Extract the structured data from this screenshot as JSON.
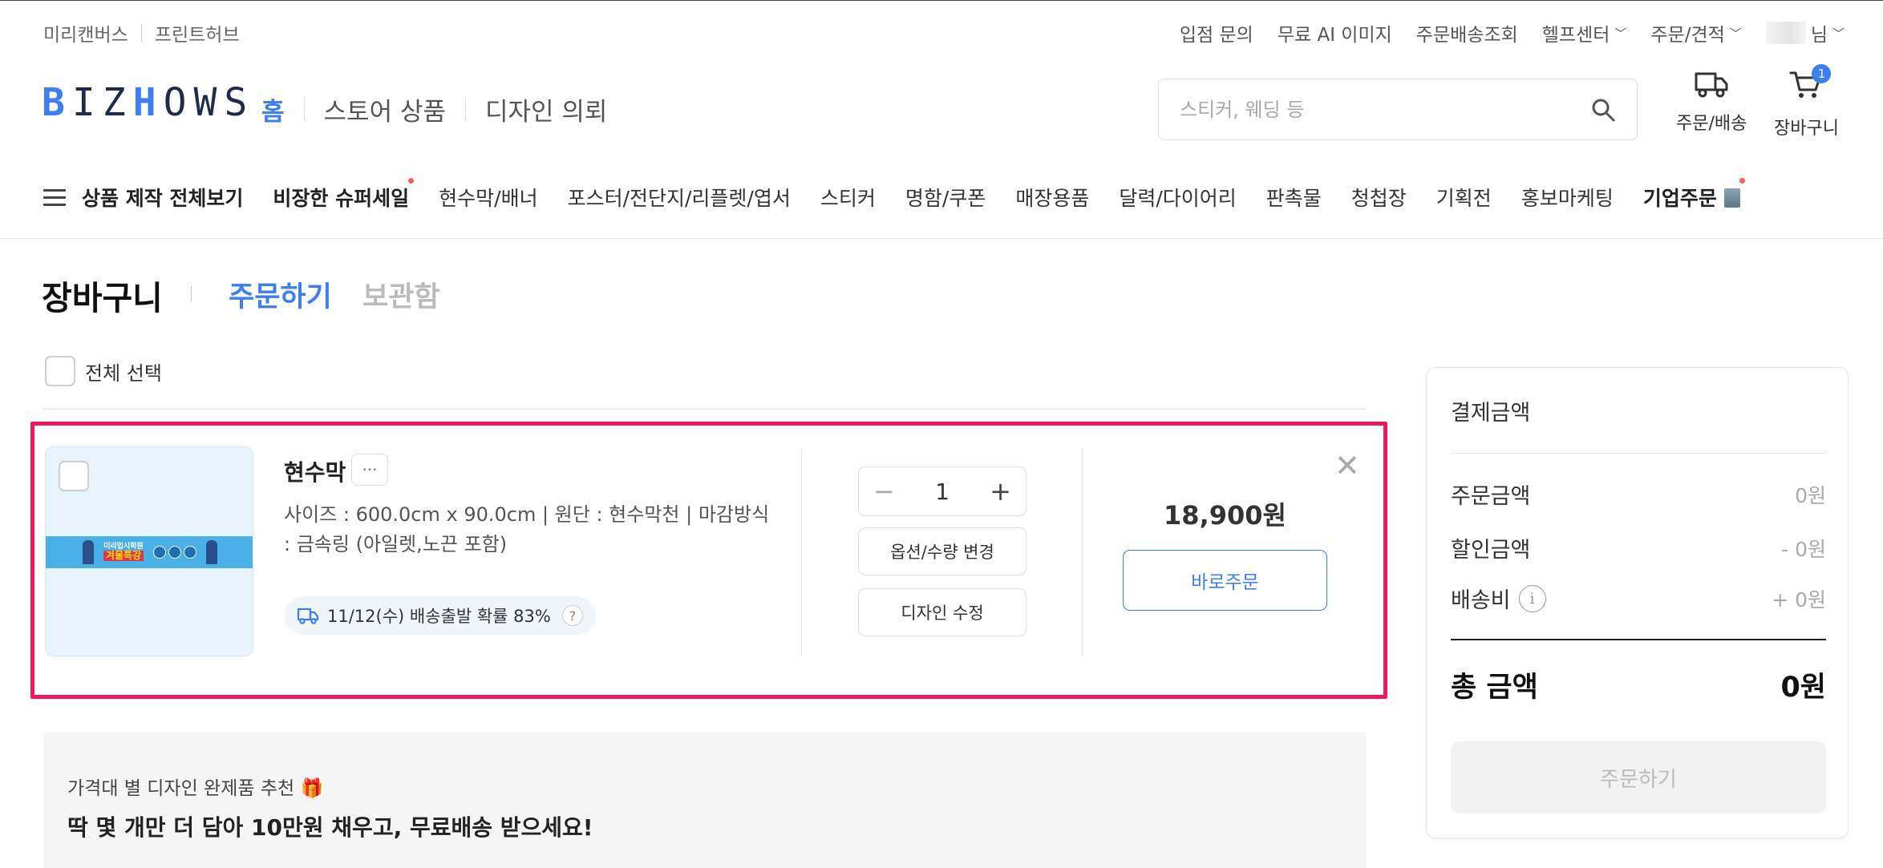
{
  "util": {
    "left": [
      "미리캔버스",
      "프린트허브"
    ],
    "right": {
      "store_apply": "입점 문의",
      "free_ai": "무료 AI 이미지",
      "track": "주문배송조회",
      "help": "헬프센터",
      "order_quote": "주문/견적",
      "user_suffix": "님"
    }
  },
  "header": {
    "logo": "BIZHOWS",
    "nav": [
      "홈",
      "스토어 상품",
      "디자인 의뢰"
    ],
    "search_placeholder": "스티커, 웨딩 등",
    "icons": {
      "orders": "주문/배송",
      "cart": "장바구니",
      "cart_count": "1"
    }
  },
  "category_nav": {
    "all": "상품 제작 전체보기",
    "items": [
      "비장한 슈퍼세일",
      "현수막/배너",
      "포스터/전단지/리플렛/엽서",
      "스티커",
      "명함/쿠폰",
      "매장용품",
      "달력/다이어리",
      "판촉물",
      "청첩장",
      "기획전",
      "홍보마케팅",
      "기업주문"
    ]
  },
  "page": {
    "title": "장바구니",
    "tabs": [
      "주문하기",
      "보관함"
    ],
    "select_all": "전체 선택"
  },
  "cart_item": {
    "name": "현수막",
    "more": "···",
    "desc": "사이즈 : 600.0cm x 90.0cm | 원단 : 현수막천 | 마감방식 : 금속링 (아일렛,노끈 포함)",
    "shipping": "11/12(수) 배송출발 확률 83%",
    "qty": "1",
    "option_btn": "옵션/수량 변경",
    "design_btn": "디자인 수정",
    "price": "18,900원",
    "buy_now": "바로주문",
    "thumb_text": [
      "미리입시학원",
      "겨울특강"
    ]
  },
  "summary": {
    "title": "결제금액",
    "order_amount_label": "주문금액",
    "order_amount": "0원",
    "discount_label": "할인금액",
    "discount": "- 0원",
    "shipping_label": "배송비",
    "shipping": "+ 0원",
    "total_label": "총 금액",
    "total": "0원",
    "order_btn": "주문하기"
  },
  "reco": {
    "subtitle": "가격대 별 디자인 완제품 추천 🎁",
    "title": "딱 몇 개만 더 담아 10만원 채우고, 무료배송 받으세요!"
  },
  "colors": {
    "accent": "#3d7ef0",
    "highlight": "#ee1a5c",
    "new_dot": "#ff5a5a"
  }
}
